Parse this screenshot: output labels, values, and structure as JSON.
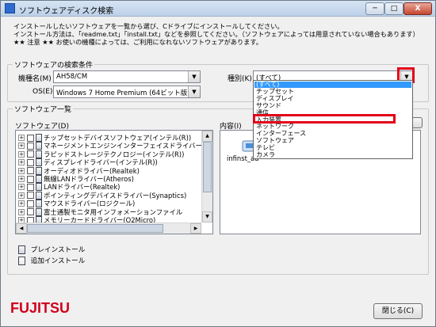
{
  "window": {
    "title": "ソフトウェアディスク検索",
    "minimize": "─",
    "maximize": "□",
    "close": "X"
  },
  "intro": {
    "line1": "インストールしたいソフトウェアを一覧から選び、Cドライブにインストールしてください。",
    "line2": "インストール方法は、「readme.txt」「install.txt」などを参照してください。（ソフトウェアによっては用意されていない場合もあります）",
    "line3": "★★ 注意 ★★ お使いの機種によっては、ご利用になれないソフトウェアがあります。"
  },
  "search_group": {
    "legend": "ソフトウェアの検索条件",
    "model_label": "機種名(M)",
    "model_value": "AH58/CM",
    "os_label": "OS(E)",
    "os_value": "Windows 7 Home Premium (64ビット版)",
    "category_label": "種別(K)",
    "category_value": "(すべて)"
  },
  "category_options": [
    "(すべて)",
    "チップセット",
    "ディスプレイ",
    "サウンド",
    "通信",
    "入力装置",
    "ネットワーク",
    "インターフェース",
    "ソフトウェア",
    "テレビ",
    "カメラ"
  ],
  "category_selected_index": 0,
  "category_highlight_index": 5,
  "list_group": {
    "legend": "ソフトウェア一覧",
    "software_label": "ソフトウェア(D)",
    "content_label": "内容(I)"
  },
  "software_items": [
    "チップセットデバイスソフトウェア(インテル(R))",
    "マネージメントエンジンインターフェイスドライバー(インテル",
    "ラピッドストレージテクノロジー(インテル(R))",
    "ディスプレイドライバー(インテル(R))",
    "オーディオドライバー(Realtek)",
    "無線LANドライバー(Atheros)",
    "LANドライバー(Realtek)",
    "ポインティングデバイスドライバー(Synaptics)",
    "マウスドライバー(ロジクール)",
    "富士通製モニタ用インフォメーションファイル",
    "メモリーカードドライバー(O2Micro)"
  ],
  "content_file": "infinst_au",
  "legend_items": {
    "preinstall": "プレインストール",
    "add_install": "追加インストール"
  },
  "footer": {
    "brand": "FUJITSU",
    "close_button": "閉じる(C)"
  },
  "colors": {
    "highlight": "#e2001a",
    "selection": "#3399ff",
    "brand": "#d0021b"
  }
}
